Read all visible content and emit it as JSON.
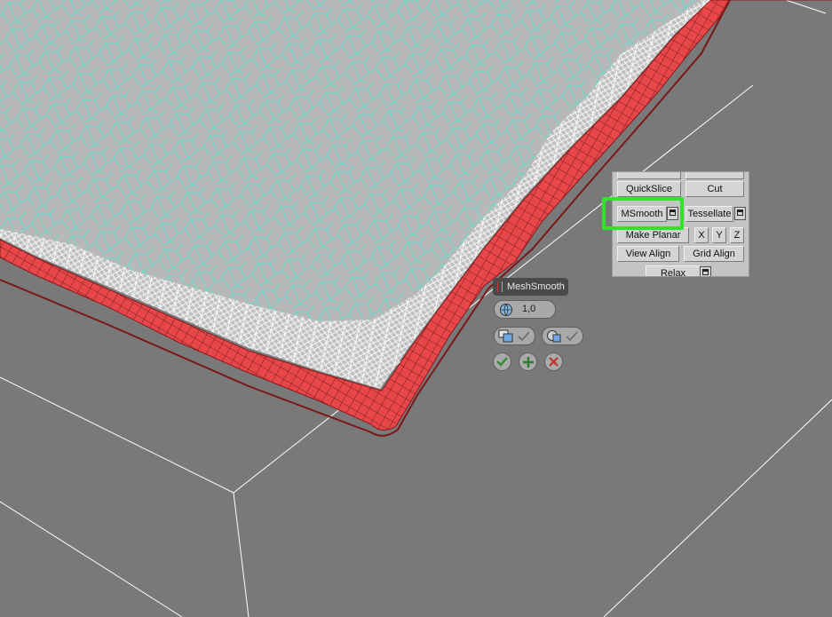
{
  "panel": {
    "quickslice": "QuickSlice",
    "cut": "Cut",
    "msmooth": "MSmooth",
    "tessellate": "Tessellate",
    "make_planar": "Make Planar",
    "x": "X",
    "y": "Y",
    "z": "Z",
    "view_align": "View Align",
    "grid_align": "Grid Align",
    "relax": "Relax"
  },
  "caddy": {
    "title": "MeshSmooth",
    "smoothness_value": "1,0",
    "ok_icon": "check-icon",
    "apply_icon": "plus-icon",
    "cancel_icon": "x-icon"
  },
  "colors": {
    "viewport_bg": "#797979",
    "mesh_fill": "#b8b8b8",
    "mesh_wire": "#5fe0cc",
    "selected_faces": "#e8474a",
    "highlight": "#2fe32f"
  }
}
